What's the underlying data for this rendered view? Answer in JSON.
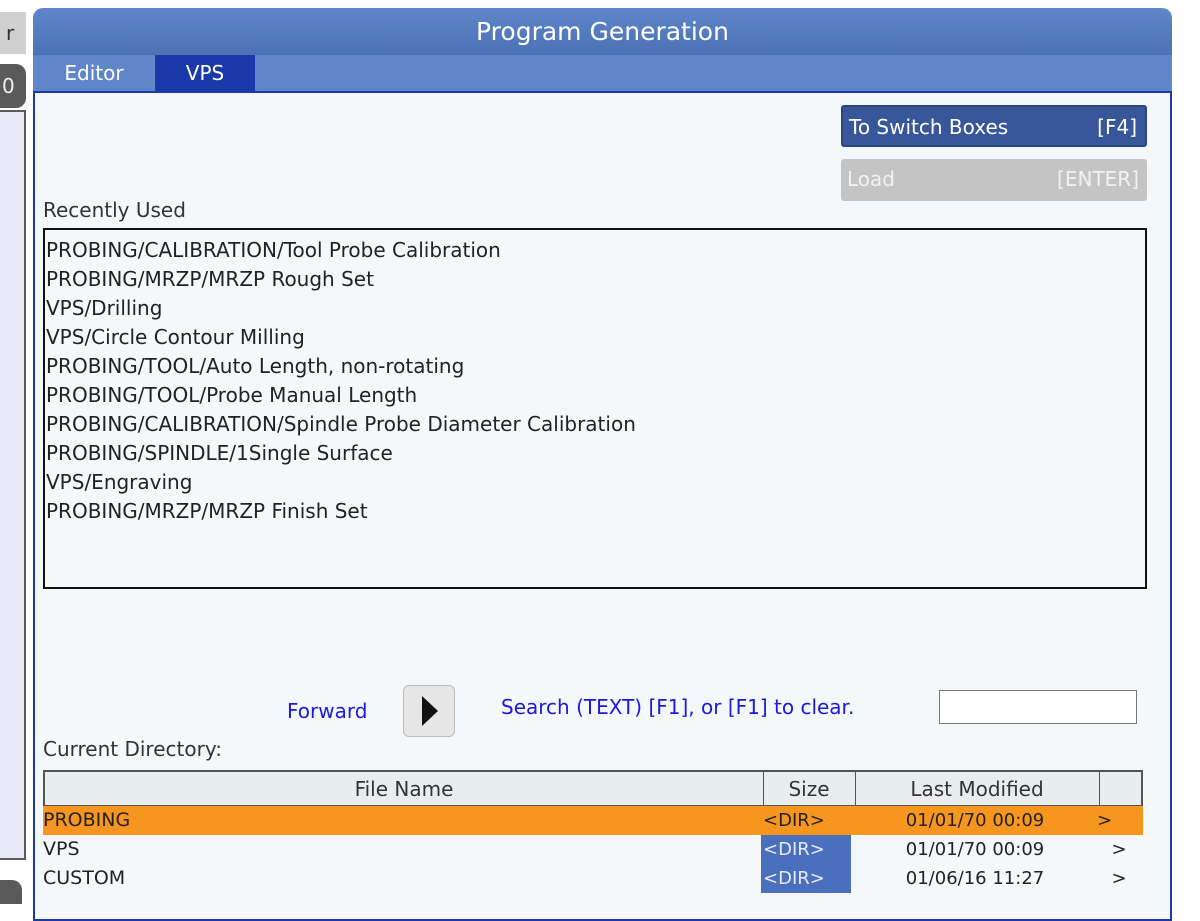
{
  "left_panel": {
    "tab_char": "r",
    "dark_char": "0"
  },
  "window": {
    "title": "Program Generation",
    "tabs": [
      {
        "label": "Editor",
        "active": false
      },
      {
        "label": "VPS",
        "active": true
      }
    ]
  },
  "buttons": {
    "switch": {
      "label": "To Switch Boxes",
      "key": "[F4]"
    },
    "load": {
      "label": "Load",
      "key": "[ENTER]",
      "enabled": false
    }
  },
  "recent": {
    "label": "Recently Used",
    "items": [
      "PROBING/CALIBRATION/Tool Probe Calibration",
      "PROBING/MRZP/MRZP Rough Set",
      "VPS/Drilling",
      "VPS/Circle Contour Milling",
      "PROBING/TOOL/Auto Length, non-rotating",
      "PROBING/TOOL/Probe Manual Length",
      "PROBING/CALIBRATION/Spindle Probe Diameter Calibration",
      "PROBING/SPINDLE/1Single Surface",
      "VPS/Engraving",
      "PROBING/MRZP/MRZP Finish Set"
    ]
  },
  "navigation": {
    "forward_label": "Forward",
    "search_label": "Search (TEXT) [F1], or [F1] to clear.",
    "search_value": ""
  },
  "directory": {
    "label": "Current Directory:",
    "columns": {
      "name": "File Name",
      "size": "Size",
      "modified": "Last Modified",
      "arrow": ""
    },
    "rows": [
      {
        "name": "PROBING",
        "size": "<DIR>",
        "modified": "01/01/70 00:09",
        "arrow": ">"
      },
      {
        "name": "VPS",
        "size": "<DIR>",
        "modified": "01/01/70 00:09",
        "arrow": ">"
      },
      {
        "name": "CUSTOM",
        "size": "<DIR>",
        "modified": "01/06/16 11:27",
        "arrow": ">"
      }
    ],
    "selected_row": 0
  },
  "colors": {
    "title_bar": "#5e86c9",
    "active_tab": "#1a3aaa",
    "selected_row": "#f7961e",
    "dir_cell": "#4a70bd",
    "link_text": "#1a1adc"
  }
}
